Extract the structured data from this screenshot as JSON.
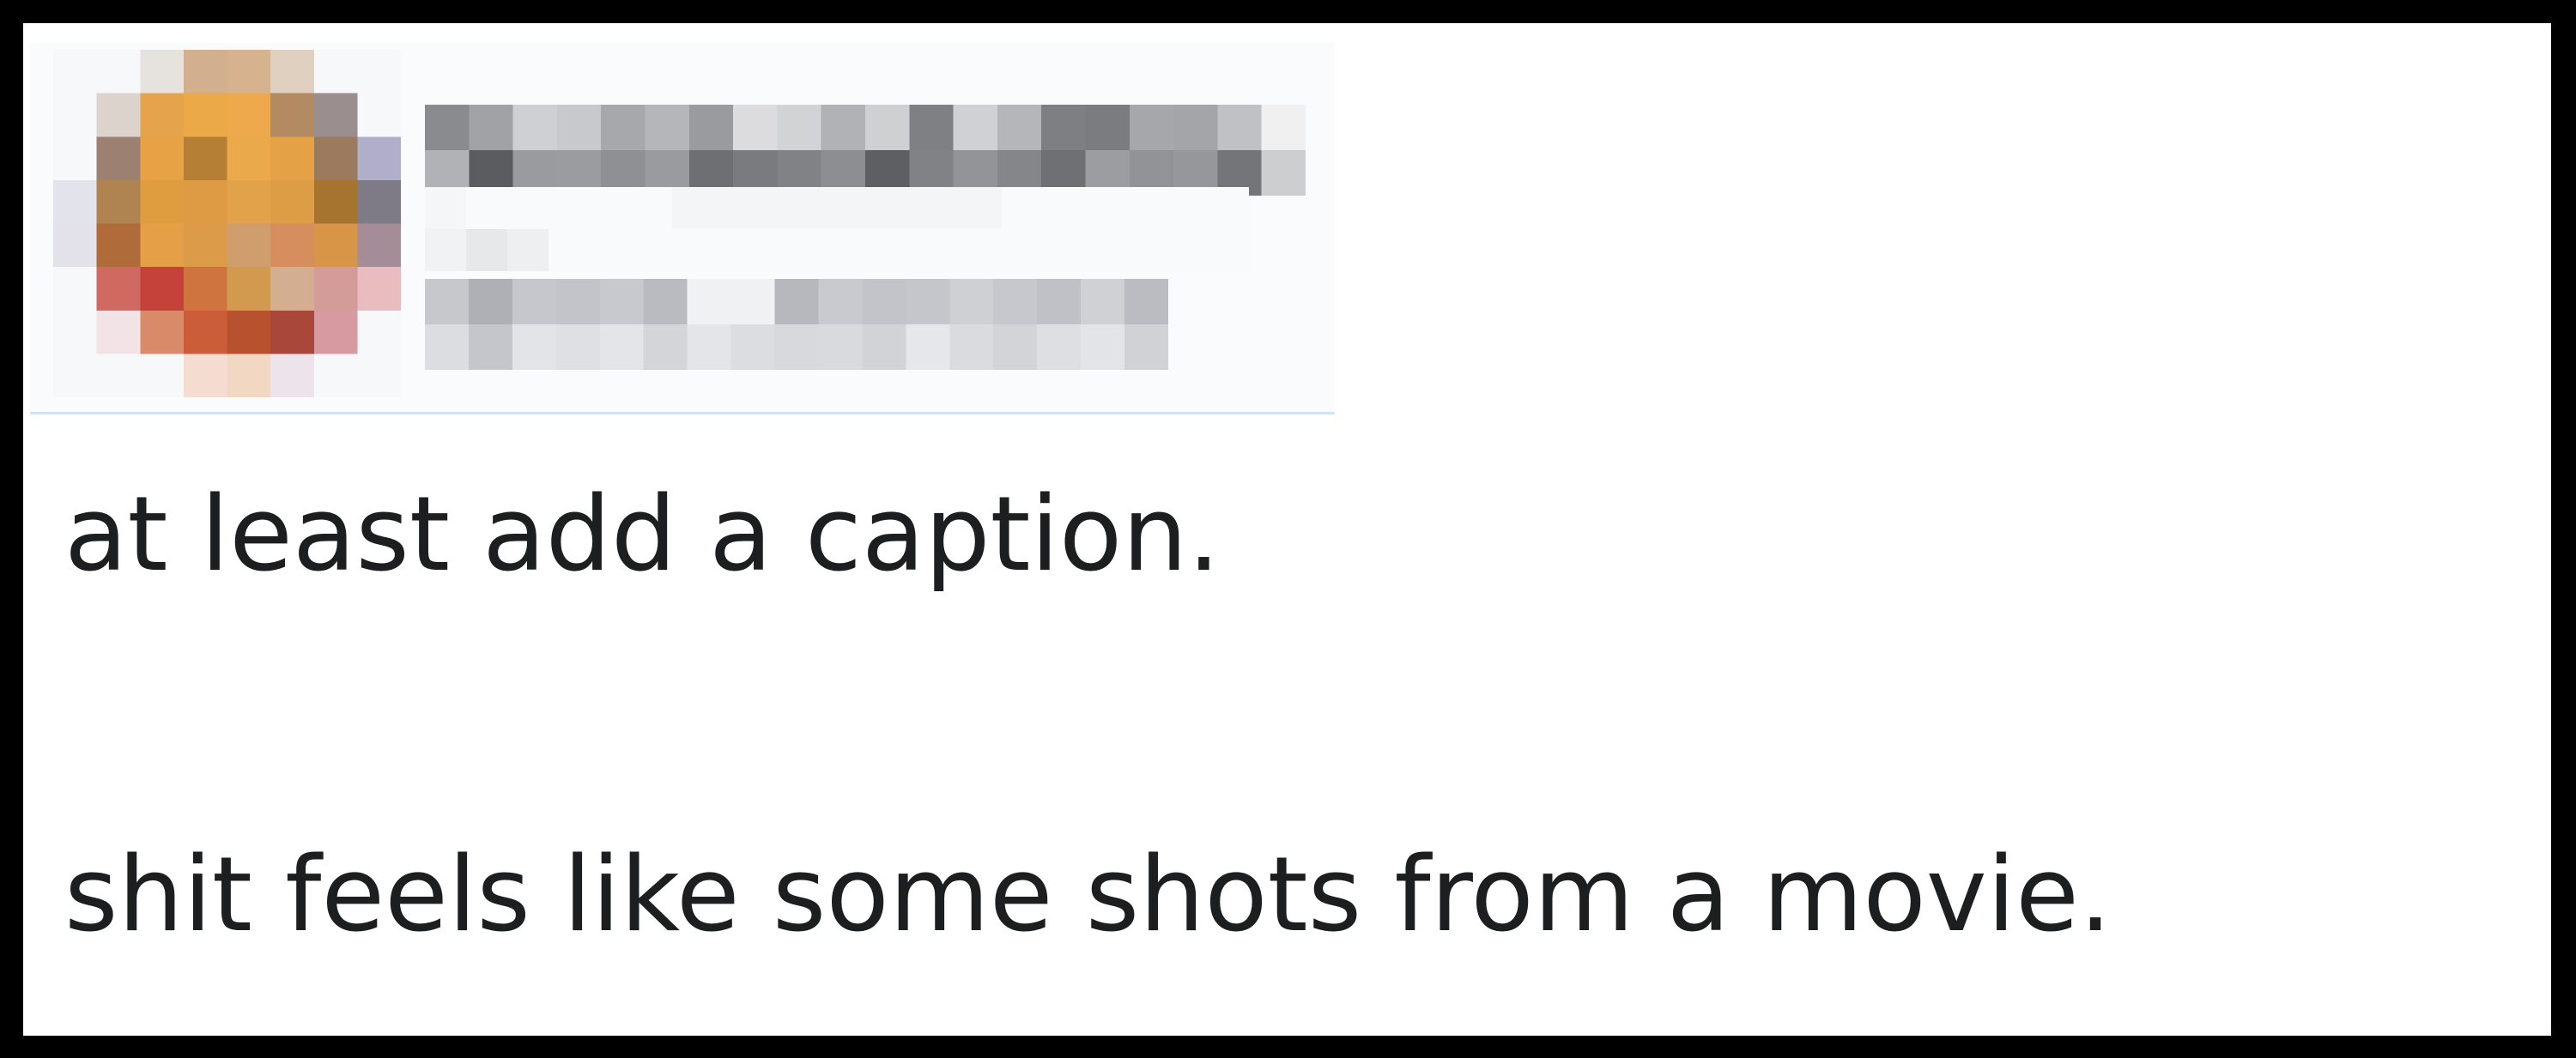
{
  "post": {
    "author": {
      "avatar": {
        "icon": "avatar-pixelated"
      },
      "display_name": "",
      "handle": ""
    },
    "body_lines": [
      "at least add a caption.",
      "shit feels like some shots from a movie."
    ]
  },
  "colors": {
    "frame": "#000000",
    "card_background": "#ffffff",
    "header_background": "#f9fbfd",
    "header_divider": "#cfe4f3",
    "text": "#1d1e20"
  }
}
